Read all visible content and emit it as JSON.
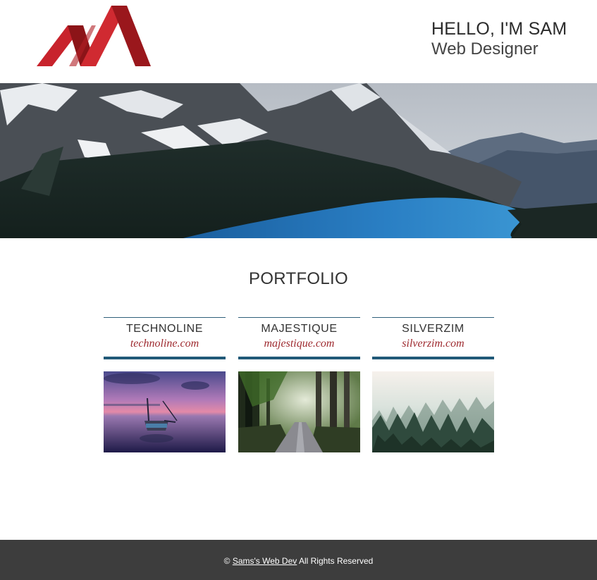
{
  "header": {
    "logo_icon": "red-m-logo",
    "name": "HELLO, I'M SAM",
    "role": "Web Designer"
  },
  "hero": {
    "image": "mountain-lake-landscape"
  },
  "portfolio": {
    "title": "PORTFOLIO",
    "items": [
      {
        "name": "TECHNOLINE",
        "url": "technoline.com",
        "image": "boat-at-sunset"
      },
      {
        "name": "MAJESTIQUE",
        "url": "majestique.com",
        "image": "forest-road"
      },
      {
        "name": "SILVERZIM",
        "url": "silverzim.com",
        "image": "misty-pine-forest"
      }
    ]
  },
  "footer": {
    "copyright_symbol": "©",
    "link_text": "Sams's Web Dev",
    "rights_text": "All Rights Reserved"
  },
  "colors": {
    "logo_red": "#c8232c",
    "card_border": "#215a78",
    "url_red": "#9e2a2f",
    "footer_bg": "#3d3d3d"
  }
}
